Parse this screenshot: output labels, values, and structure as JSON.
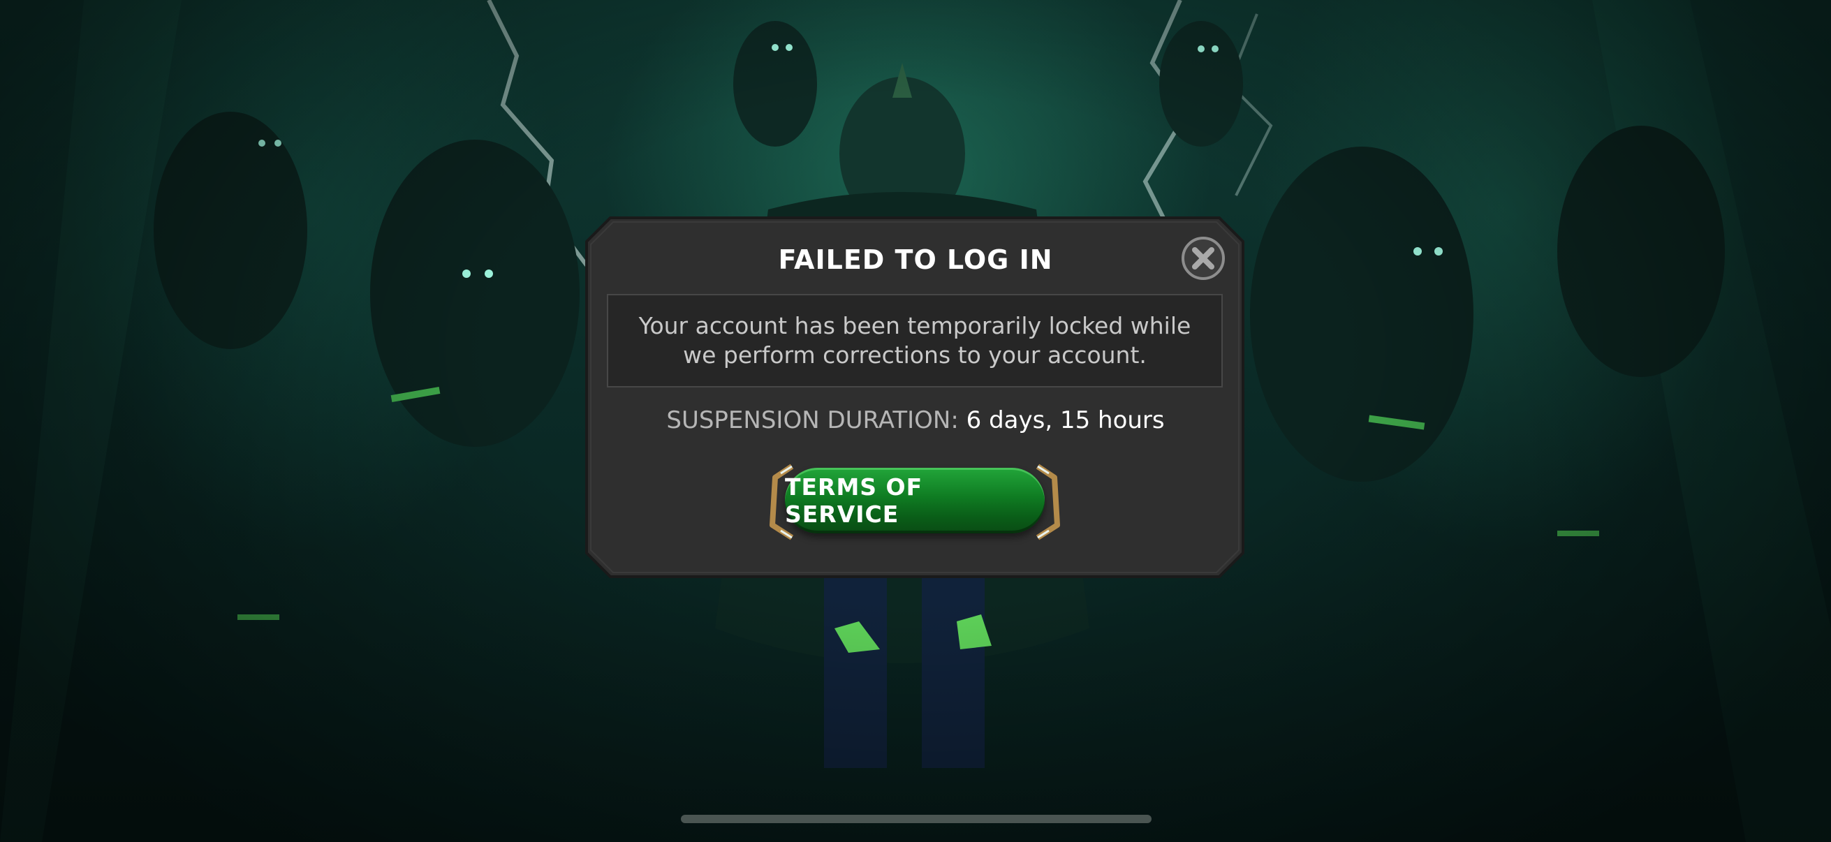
{
  "dialog": {
    "title": "FAILED TO LOG IN",
    "message": "Your account has been temporarily locked while we perform corrections to your account.",
    "suspension_label": "SUSPENSION DURATION:",
    "suspension_value": "6 days, 15 hours",
    "tos_button_label": "TERMS OF SERVICE",
    "close_icon": "close-icon"
  },
  "colors": {
    "dialog_bg": "#2f2f2f",
    "button_green": "#0f7b22",
    "accent_gold": "#b48b4a"
  }
}
